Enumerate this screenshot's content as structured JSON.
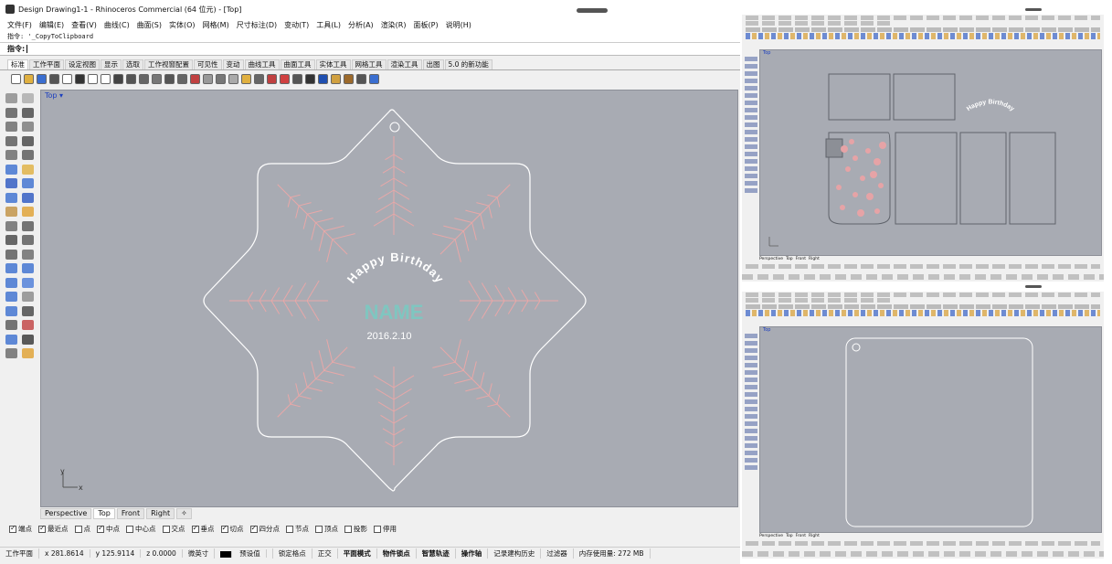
{
  "main_window": {
    "title": "Design Drawing1-1 - Rhinoceros Commercial (64 位元) - [Top]",
    "menu": [
      "文件(F)",
      "编辑(E)",
      "查看(V)",
      "曲线(C)",
      "曲面(S)",
      "实体(O)",
      "网格(M)",
      "尺寸标注(D)",
      "变动(T)",
      "工具(L)",
      "分析(A)",
      "渲染(R)",
      "面板(P)",
      "说明(H)"
    ],
    "command_history": "指令: '_CopyToClipboard",
    "command_prompt": "指令:",
    "toolbar_tabs": [
      "标准",
      "工作平面",
      "设定视图",
      "显示",
      "选取",
      "工作视窗配置",
      "可见性",
      "变动",
      "曲线工具",
      "曲面工具",
      "实体工具",
      "网格工具",
      "渲染工具",
      "出图",
      "5.0 的新功能"
    ],
    "active_tab": "标准",
    "viewport_label": "Top",
    "drawing": {
      "greeting": "Happy Birthday",
      "name_placeholder": "NAME",
      "date": "2016.2.10"
    },
    "axes": {
      "x": "x",
      "y": "y"
    },
    "view_tabs": [
      "Perspective",
      "Top",
      "Front",
      "Right"
    ],
    "active_view": "Top",
    "osnaps": [
      {
        "label": "端点",
        "checked": true
      },
      {
        "label": "最近点",
        "checked": true
      },
      {
        "label": "点",
        "checked": false
      },
      {
        "label": "中点",
        "checked": true
      },
      {
        "label": "中心点",
        "checked": false
      },
      {
        "label": "交点",
        "checked": false
      },
      {
        "label": "垂点",
        "checked": true
      },
      {
        "label": "切点",
        "checked": true
      },
      {
        "label": "四分点",
        "checked": true
      },
      {
        "label": "节点",
        "checked": false
      },
      {
        "label": "顶点",
        "checked": false
      },
      {
        "label": "投影",
        "checked": false
      },
      {
        "label": "停用",
        "checked": false
      }
    ],
    "status": {
      "cplane": "工作平面",
      "x": "x 281.8614",
      "y": "y 125.9114",
      "z": "z 0.0000",
      "units": "微英寸",
      "layer": "预设值",
      "toggles": [
        "锁定格点",
        "正交",
        "平面模式",
        "物件锁点",
        "智慧轨迹",
        "操作轴",
        "记录建构历史",
        "过滤器"
      ],
      "memory": "内存使用量: 272 MB"
    }
  },
  "side_window_1": {
    "viewport_label": "Top",
    "greeting": "Happy Birthday",
    "view_tabs": [
      "Perspective",
      "Top",
      "Front",
      "Right"
    ]
  },
  "side_window_2": {
    "viewport_label": "Top",
    "view_tabs": [
      "Perspective",
      "Top",
      "Front",
      "Right"
    ]
  },
  "colors": {
    "viewport_bg": "#a8abb3",
    "outline": "#ffffff",
    "snowflake": "#e8a8a8",
    "name_text": "#7fc6c0",
    "label_blue": "#1c3fbf"
  }
}
